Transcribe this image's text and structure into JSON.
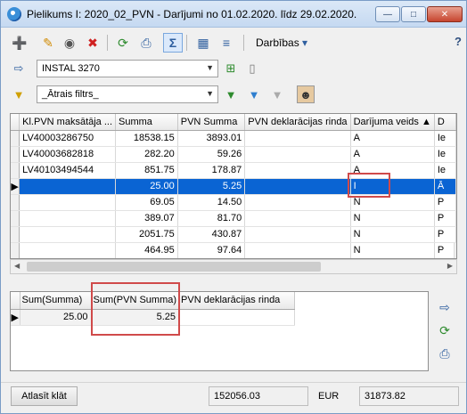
{
  "window": {
    "title": "Pielikums I: 2020_02_PVN - Darījumi no 01.02.2020. līdz 29.02.2020."
  },
  "toolbar": {
    "menu_label": "Darbības",
    "help": "?"
  },
  "selectors": {
    "partner": "INSTAL 3270",
    "filter": "_Ātrais filtrs_"
  },
  "grid": {
    "columns": [
      "Kl.PVN maksātāja ...",
      "Summa",
      "PVN Summa",
      "PVN deklarācijas rinda",
      "Darījuma veids",
      "D"
    ],
    "rows": [
      {
        "kl": "LV40003286750",
        "summa": "18538.15",
        "pvn": "3893.01",
        "rinda": "",
        "veids": "A",
        "d": "Ie",
        "selected": false
      },
      {
        "kl": "LV40003682818",
        "summa": "282.20",
        "pvn": "59.26",
        "rinda": "",
        "veids": "A",
        "d": "Ie",
        "selected": false
      },
      {
        "kl": "LV40103494544",
        "summa": "851.75",
        "pvn": "178.87",
        "rinda": "",
        "veids": "A",
        "d": "Ie",
        "selected": false
      },
      {
        "kl": "",
        "summa": "25.00",
        "pvn": "5.25",
        "rinda": "",
        "veids": "I",
        "d": "Ā",
        "selected": true
      },
      {
        "kl": "",
        "summa": "69.05",
        "pvn": "14.50",
        "rinda": "",
        "veids": "N",
        "d": "P",
        "selected": false
      },
      {
        "kl": "",
        "summa": "389.07",
        "pvn": "81.70",
        "rinda": "",
        "veids": "N",
        "d": "P",
        "selected": false
      },
      {
        "kl": "",
        "summa": "2051.75",
        "pvn": "430.87",
        "rinda": "",
        "veids": "N",
        "d": "P",
        "selected": false
      },
      {
        "kl": "",
        "summa": "464.95",
        "pvn": "97.64",
        "rinda": "",
        "veids": "N",
        "d": "P",
        "selected": false
      }
    ]
  },
  "summary": {
    "columns": [
      "Sum(Summa)",
      "Sum(PVN Summa)",
      "PVN deklarācijas rinda"
    ],
    "row": {
      "sum_summa": "25.00",
      "sum_pvn": "5.25",
      "rinda": ""
    }
  },
  "status": {
    "clear_button": "Atlasīt klāt",
    "total_summa": "152056.03",
    "currency": "EUR",
    "total_pvn": "31873.82"
  },
  "colors": {
    "selection": "#0a64d3",
    "highlight": "#d04a4a"
  }
}
